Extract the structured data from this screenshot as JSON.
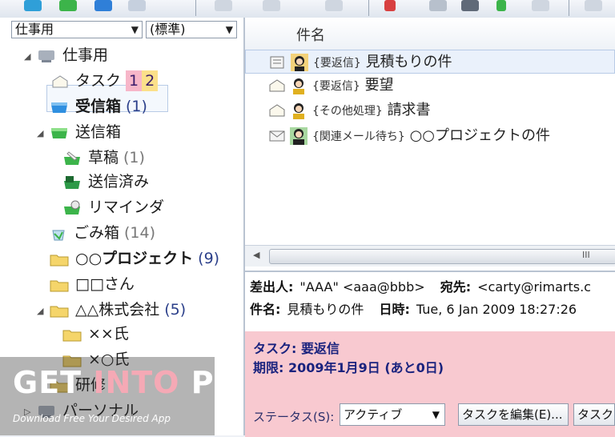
{
  "folder_pane": {
    "account_combo": "仕事用",
    "view_combo": "(標準)",
    "tree": [
      {
        "label": "仕事用",
        "count": "",
        "bold": false
      },
      {
        "label": "タスク",
        "count": "",
        "bold": false,
        "badge1": "1",
        "badge2": "2"
      },
      {
        "label": "受信箱",
        "count": "(1)",
        "bold": true
      },
      {
        "label": "送信箱",
        "count": "",
        "bold": false
      },
      {
        "label": "草稿",
        "count": "(1)",
        "bold": false
      },
      {
        "label": "送信済み",
        "count": "",
        "bold": false
      },
      {
        "label": "リマインダ",
        "count": "",
        "bold": false
      },
      {
        "label": "ごみ箱",
        "count": "(14)",
        "bold": false
      },
      {
        "label": "○○プロジェクト",
        "count": "(9)",
        "bold": true
      },
      {
        "label": "□□さん",
        "count": "",
        "bold": false
      },
      {
        "label": "△△株式会社",
        "count": "(5)",
        "bold": false
      },
      {
        "label": "××氏",
        "count": "",
        "bold": false
      },
      {
        "label": "×○氏",
        "count": "",
        "bold": false
      },
      {
        "label": "研修",
        "count": "",
        "bold": false
      },
      {
        "label": "パーソナル",
        "count": "",
        "bold": false
      }
    ]
  },
  "message_list": {
    "column_header": "件名",
    "messages": [
      {
        "tag": "{要返信}",
        "subject": "見積もりの件"
      },
      {
        "tag": "{要返信}",
        "subject": "要望"
      },
      {
        "tag": "{その他処理}",
        "subject": "請求書"
      },
      {
        "tag": "{関連メール待ち}",
        "subject": "○○プロジェクトの件"
      }
    ],
    "scroll_grip": "III"
  },
  "preview": {
    "from_label": "差出人:",
    "from_value": "\"AAA\" <aaa@bbb>",
    "to_label": "宛先:",
    "to_value": "<carty@rimarts.c",
    "subject_label": "件名:",
    "subject_value": "見積もりの件",
    "date_label": "日時:",
    "date_value": "Tue, 6 Jan 2009 18:27:26",
    "task_label": "タスク:",
    "task_value": "要返信",
    "due_label": "期限:",
    "due_value": "2009年1月9日 (あと0日)",
    "status_label": "ステータス(S):",
    "status_value": "アクティブ",
    "edit_task_button": "タスクを編集(E)...",
    "task_button2": "タスクを"
  },
  "watermark": {
    "line1_a": "GET ",
    "line1_b": "INTO",
    "line1_c": " PC",
    "line2": "Download Free Your Desired App"
  },
  "colors": {
    "task_bg": "#f8c9d0",
    "selection": "#eaf1fb",
    "count_text": "#2b3f8a"
  }
}
